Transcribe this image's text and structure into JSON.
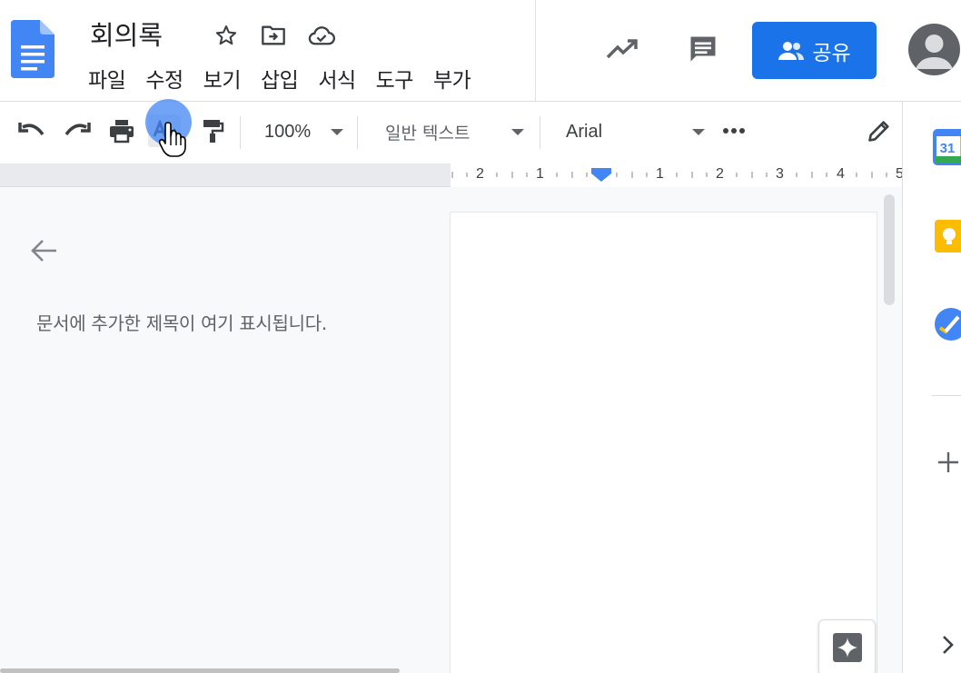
{
  "header": {
    "doc_title": "회의록",
    "menu": [
      "파일",
      "수정",
      "보기",
      "삽입",
      "서식",
      "도구",
      "부가"
    ],
    "share_label": "공유"
  },
  "toolbar": {
    "zoom": "100%",
    "style": "일반 텍스트",
    "font": "Arial"
  },
  "ruler": {
    "ticks": [
      "2",
      "1",
      "1",
      "2",
      "3",
      "4",
      "5"
    ]
  },
  "outline": {
    "hint": "문서에 추가한 제목이 여기 표시됩니다."
  },
  "side_panel": {
    "calendar_day": "31"
  },
  "colors": {
    "accent": "#1a73e8",
    "docs_blue": "#4285f4",
    "keep_yellow": "#fbbc04",
    "tasks_blue": "#4285f4"
  }
}
